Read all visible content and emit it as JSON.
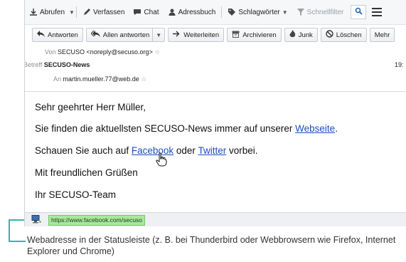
{
  "toolbar": {
    "abrufen": "Abrufen",
    "verfassen": "Verfassen",
    "chat": "Chat",
    "adressbuch": "Adressbuch",
    "schlagwoerter": "Schlagwörter",
    "schnellfilter": "Schnellfilter"
  },
  "actions": {
    "antworten": "Antworten",
    "allen_antworten": "Allen antworten",
    "weiterleiten": "Weiterleiten",
    "archivieren": "Archivieren",
    "junk": "Junk",
    "loeschen": "Löschen",
    "mehr": "Mehr"
  },
  "header": {
    "von_label": "Von",
    "von_value": "SECUSO <noreply@secuso.org>",
    "betreff_label": "Betreff",
    "betreff_value": "SECUSO-News",
    "time": "19:",
    "an_label": "An",
    "an_value": "martin.mueller.77@web.de"
  },
  "body": {
    "greeting": "Sehr geehrter Herr Müller,",
    "line1_pre": "Sie finden die aktuellsten SECUSO-News immer auf unserer ",
    "line1_link": "Webseite",
    "line1_post": ".",
    "line2_pre": "Schauen Sie auch auf ",
    "line2_link1": "Facebook",
    "line2_mid": " oder ",
    "line2_link2": "Twitter",
    "line2_post": " vorbei.",
    "closing": "Mit freundlichen Grüßen",
    "signature": "Ihr SECUSO-Team"
  },
  "statusbar": {
    "url": "https://www.facebook.com/secuso"
  },
  "caption": "Webadresse in der Statusleiste (z. B. bei Thunderbird oder Webbrowsern wie Firefox, Internet Explorer und Chrome)",
  "colors": {
    "accent": "#38b4a8",
    "link": "#1a4fc0",
    "url_highlight": "#a8e89d"
  }
}
